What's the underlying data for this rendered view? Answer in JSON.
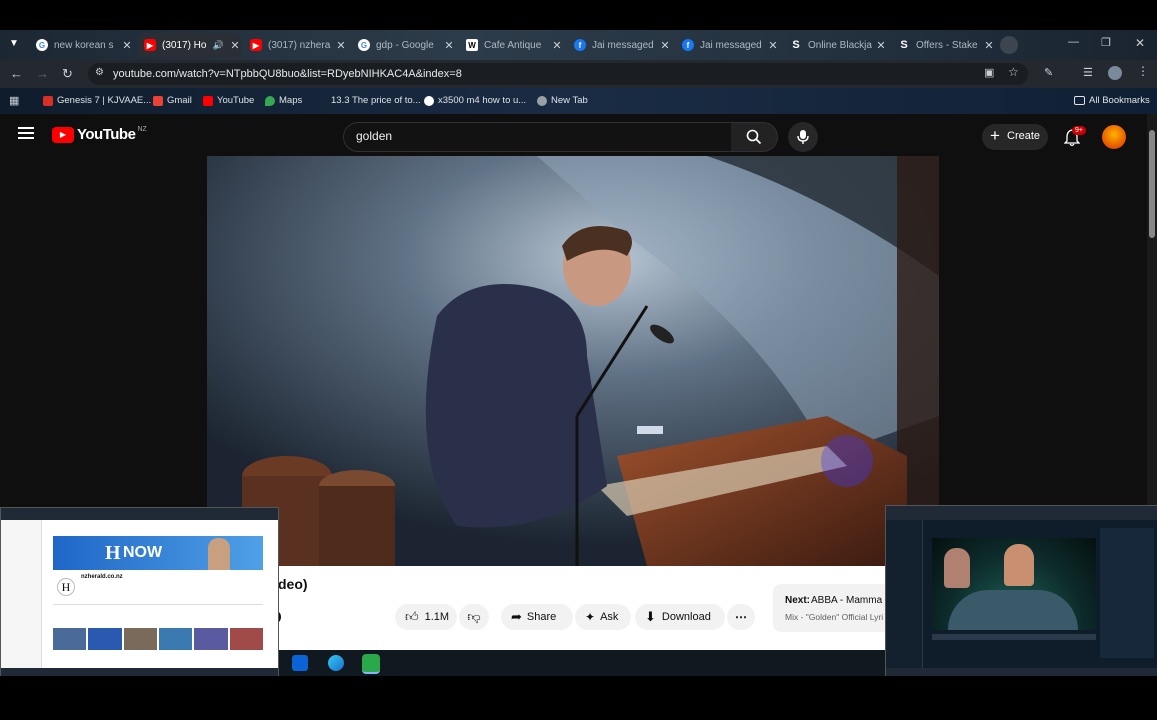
{
  "browser": {
    "tabs": [
      {
        "title": "new korean s",
        "icon": "google-icon"
      },
      {
        "title": "(3017) Ho",
        "icon": "youtube-icon",
        "active": true
      },
      {
        "title": "(3017) nzhera",
        "icon": "youtube-icon"
      },
      {
        "title": "gdp - Google",
        "icon": "google-icon"
      },
      {
        "title": "Cafe Antique",
        "icon": "wikipedia-icon"
      },
      {
        "title": "Jai messaged",
        "icon": "facebook-icon"
      },
      {
        "title": "Jai messaged",
        "icon": "facebook-icon"
      },
      {
        "title": "Online Blackja",
        "icon": "stake-icon"
      },
      {
        "title": "Offers - Stake",
        "icon": "stake-icon"
      }
    ],
    "url": "youtube.com/watch?v=NTpbbQU8buo&list=RDyebNIHKAC4A&index=8",
    "bookmarks": [
      {
        "label": "Genesis 7 | KJVAAE...",
        "color": "#d93025"
      },
      {
        "label": "Gmail",
        "color": "#ea4335"
      },
      {
        "label": "YouTube",
        "color": "#ff0000"
      },
      {
        "label": "Maps",
        "color": "#34a853"
      },
      {
        "label": "13.3 The price of to...",
        "color": "#5f6368"
      },
      {
        "label": "x3500 m4 how to u...",
        "color": "#4285f4"
      },
      {
        "label": "New Tab",
        "color": "#9aa0a6"
      }
    ],
    "all_bookmarks": "All Bookmarks"
  },
  "youtube": {
    "logo_text": "YouTube",
    "region": "NZ",
    "search_value": "golden",
    "create_label": "Create",
    "notification_badge": "9+",
    "video_title_fragment": "deo)",
    "like_count": "1.1M",
    "share_label": "Share",
    "ask_label": "Ask",
    "download_label": "Download",
    "next_label": "Next:",
    "next_title": "ABBA - Mamma",
    "next_subtitle": "Mix - \"Golden\" Official Lyri"
  },
  "pip_left": {
    "banner_text": "NOW",
    "channel_name": "nzherald.co.nz"
  }
}
